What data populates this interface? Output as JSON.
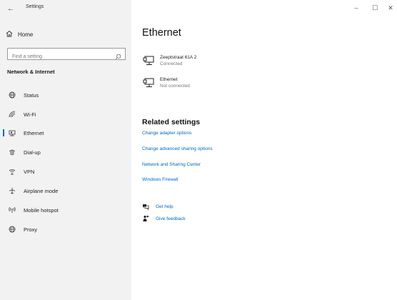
{
  "titlebar": {
    "app_title": "Settings",
    "back_label": "←",
    "minimize_label": "–",
    "maximize_label": "☐",
    "close_label": "✕"
  },
  "sidebar": {
    "home_label": "Home",
    "search_placeholder": "Find a setting",
    "section_title": "Network & Internet",
    "items": [
      {
        "label": "Status",
        "icon": "globe-icon",
        "selected": false
      },
      {
        "label": "Wi-Fi",
        "icon": "wifi-icon",
        "selected": false
      },
      {
        "label": "Ethernet",
        "icon": "ethernet-icon",
        "selected": true
      },
      {
        "label": "Dial-up",
        "icon": "dialup-icon",
        "selected": false
      },
      {
        "label": "VPN",
        "icon": "vpn-icon",
        "selected": false
      },
      {
        "label": "Airplane mode",
        "icon": "airplane-icon",
        "selected": false
      },
      {
        "label": "Mobile hotspot",
        "icon": "hotspot-icon",
        "selected": false
      },
      {
        "label": "Proxy",
        "icon": "proxy-globe-icon",
        "selected": false
      }
    ]
  },
  "main": {
    "title": "Ethernet",
    "networks": [
      {
        "name": "Zeeptstraat 61A 2",
        "status": "Connected"
      },
      {
        "name": "Ethernet",
        "status": "Not connected"
      }
    ],
    "related_title": "Related settings",
    "related_links": [
      "Change adapter options",
      "Change advanced sharing options",
      "Network and Sharing Center",
      "Windows Firewall"
    ],
    "help_links": [
      {
        "label": "Get help",
        "icon": "help-chat-icon"
      },
      {
        "label": "Give feedback",
        "icon": "feedback-icon"
      }
    ]
  },
  "colors": {
    "accent": "#0067c0",
    "sidebar_bg": "#f2f2f2"
  }
}
